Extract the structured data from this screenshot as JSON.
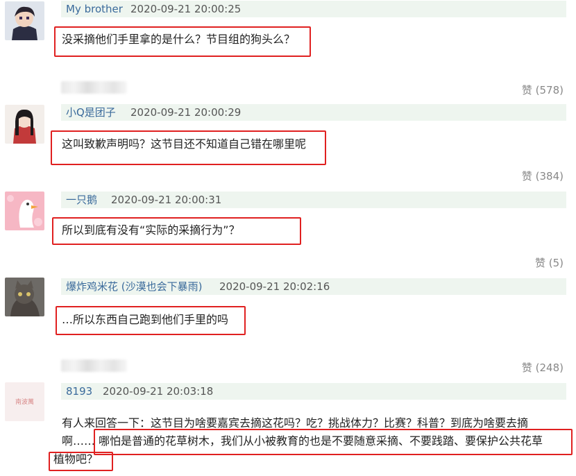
{
  "comments": [
    {
      "username": "My brother",
      "time": "2020-09-21 20:00:25",
      "text": "没采摘他们手里拿的是什么？节目组的狗头么？",
      "likes": "赞 (578)"
    },
    {
      "username": "小Q是团子",
      "time": "2020-09-21 20:00:29",
      "text": "这叫致歉声明吗？这节目还不知道自己错在哪里呢",
      "likes": "赞 (384)"
    },
    {
      "username": "一只鹅",
      "time": "2020-09-21 20:00:31",
      "text": "所以到底有没有“实际的采摘行为”？",
      "likes": "赞 (5)"
    },
    {
      "username": "爆炸鸡米花 (沙漠也会下暴雨)",
      "time": "2020-09-21 20:02:16",
      "text": "…所以东西自己跑到他们手里的吗",
      "likes": "赞 (248)"
    },
    {
      "username": "8193",
      "time": "2020-09-21 20:03:18",
      "text_line1": "有人来回答一下：这节目为啥要嘉宾去摘这花吗？吃？挑战体力？比赛？科普？到底为啥要去摘",
      "text_line2_a": "啊……",
      "text_line2_b": "哪怕是普通的花草树木，我们从小被教育的也是不要随意采摘、不要践踏、要保护公共花草",
      "text_line3": "植物吧？"
    }
  ],
  "avatar5_text": "南波萬",
  "colors": {
    "username": "#3a6a9b",
    "highlight_box": "#e02020",
    "header_bar": "#eef5ef"
  }
}
